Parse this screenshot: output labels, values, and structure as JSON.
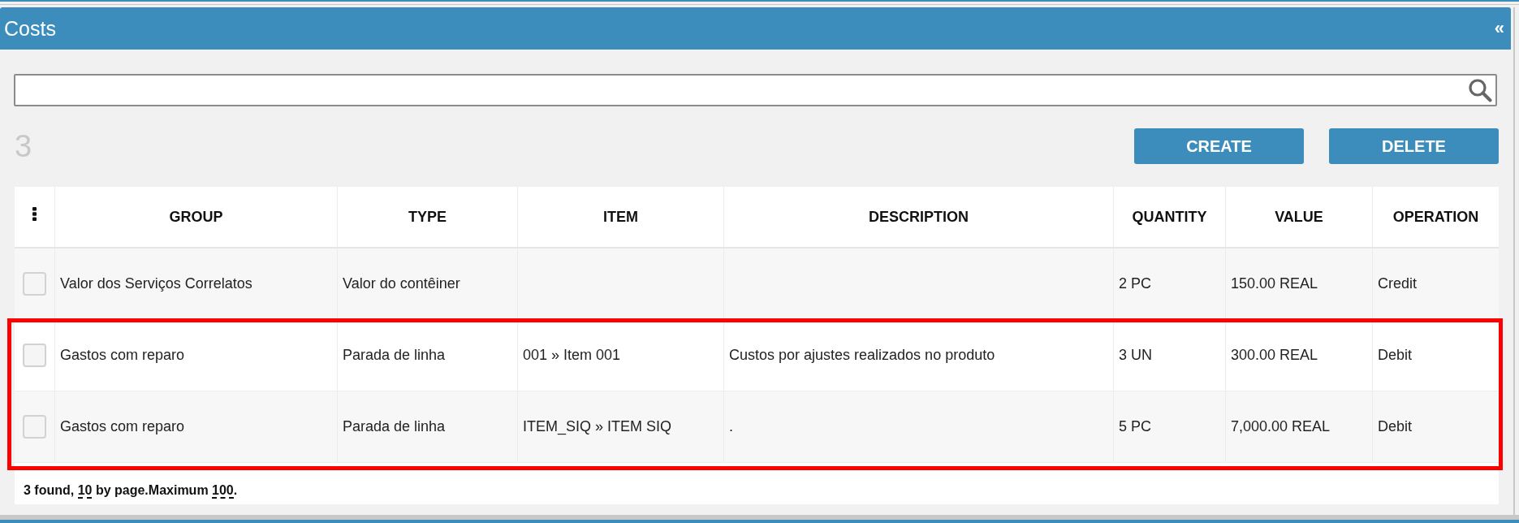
{
  "panel": {
    "title": "Costs",
    "collapse_label": "«"
  },
  "count": "3",
  "buttons": [
    {
      "label": "CREATE"
    },
    {
      "label": "DELETE"
    }
  ],
  "table": {
    "columns": [
      "GROUP",
      "TYPE",
      "ITEM",
      "DESCRIPTION",
      "QUANTITY",
      "VALUE",
      "OPERATION"
    ],
    "rows": [
      {
        "checked": false,
        "highlighted": false,
        "group": "Valor dos Serviços Correlatos",
        "type": "Valor do contêiner",
        "quantity": "2 PC",
        "value": "150.00 REAL",
        "operation": "Credit"
      },
      {
        "checked": false,
        "highlighted": true,
        "group": "Gastos com reparo",
        "type": "Parada de linha",
        "item": "001 » Item 001",
        "description": "Custos por ajustes realizados no produto",
        "quantity": "3 UN",
        "value": "300.00 REAL",
        "operation": "Debit"
      },
      {
        "checked": false,
        "highlighted": true,
        "group": "Gastos com reparo",
        "type": "Parada de linha",
        "item": "ITEM_SIQ » ITEM SIQ",
        "description": ".",
        "quantity": "5 PC",
        "value": "7,000.00 REAL",
        "operation": "Debit"
      }
    ],
    "footer": [
      {
        "kind": "text",
        "text": "3 found, "
      },
      {
        "kind": "link",
        "text": "10"
      },
      {
        "kind": "text",
        "text": " by page.Maximum "
      },
      {
        "kind": "link",
        "text": "100"
      },
      {
        "kind": "text",
        "text": "."
      }
    ]
  }
}
